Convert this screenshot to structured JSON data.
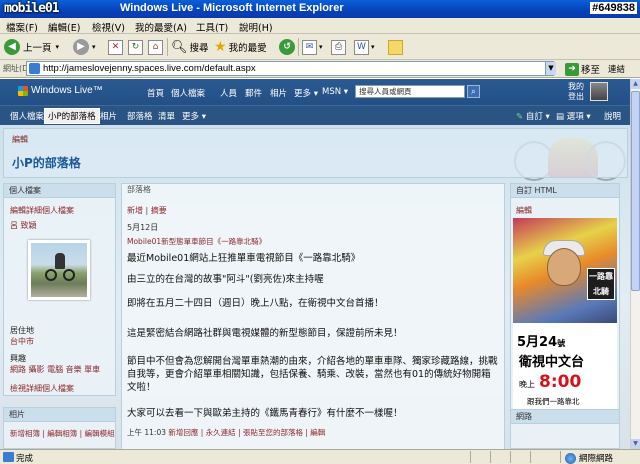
{
  "window": {
    "title": "Windows Live - Microsoft Internet Explorer",
    "watermark_logo": "mobile01",
    "watermark_id": "#649838"
  },
  "menu": {
    "items": [
      "檔案(F)",
      "編輯(E)",
      "檢視(V)",
      "我的最愛(A)",
      "工具(T)",
      "說明(H)"
    ]
  },
  "toolbar": {
    "back_label": "上一頁",
    "search_label": "搜尋",
    "favorites_label": "我的最愛"
  },
  "address": {
    "label": "網址(D)",
    "url": "http://jameslovejenny.spaces.live.com/default.aspx",
    "go_label": "移至",
    "links_label": "連結"
  },
  "wl_header": {
    "logo": "Windows Live™",
    "nav": [
      "首頁",
      "個人檔案",
      "人員",
      "郵件",
      "相片",
      "更多 ▾",
      "MSN ▾"
    ],
    "search_placeholder": "搜尋人員或網頁",
    "signout_lines": [
      "我的",
      "登出"
    ]
  },
  "space_tabs": {
    "items": [
      "個人檔案",
      "小P的部落格",
      "相片",
      "部落格",
      "清單",
      "更多 ▾"
    ],
    "active_index": 1,
    "right": [
      "自訂 ▾",
      "選項 ▾",
      "說明"
    ]
  },
  "title_panel": {
    "edit": "編輯",
    "blog_title": "小P的部落格"
  },
  "left": {
    "profile_head": "個人檔案",
    "edit_profile": "編輯詳細個人檔案",
    "name": "呂 致穎",
    "location_label": "居住地",
    "location": "台中市",
    "interests_label": "興趣",
    "interests": "網路 攝影 電腦 音樂 單車",
    "edit_profile_bottom": "檢視詳細個人檔案",
    "photos_head": "相片",
    "photos_links": "新增相簿 | 編輯相簿 | 編輯模組"
  },
  "main": {
    "head": "部落格",
    "actions": "新增 | 摘要",
    "date": "5月12日",
    "post_title": "Mobile01新型態單車節目《一路靠北騎》",
    "paragraphs": [
      "最近Mobile01網站上狂推單車電視節目《一路靠北騎》",
      "由三立的在台灣的故事\"阿斗\"(劉亮佐)來主持喔",
      "即將在五月二十四日（週日）晚上八點，在衛視中文台首播！",
      "這是緊密結合網路社群與電視媒體的新型態節目，保證前所未見！",
      "節目中不但會為您解開台灣單車熱潮的由來，介紹各地的單車車隊、獨家珍藏路線，挑戰自我等，更會介紹單車相關知識，包括保養、騎乘、改裝，當然也有01的傳統好物開箱文啦！",
      "大家可以去看一下與歐弟主持的《鐵馬青春行》有什麼不一樣喔！"
    ],
    "footer_time": "上午 11:03",
    "footer_links": "新增回應 | 永久連結 | 張貼至您的部落格 | 編輯"
  },
  "right": {
    "head": "自訂 HTML",
    "edit": "編輯",
    "bottom_head": "網路",
    "promo": {
      "date": "5月24",
      "date_suffix": "號",
      "channel": "衛視中文台",
      "time_label": "晚上",
      "time": "8:00",
      "tagline": "跟我們一路靠北",
      "badge": "一路靠北騎"
    }
  },
  "status": {
    "text": "完成",
    "zone": "網際網路"
  }
}
